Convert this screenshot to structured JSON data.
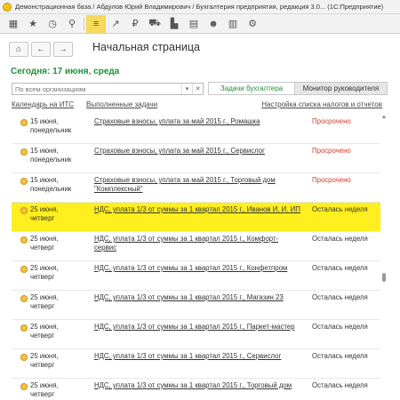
{
  "window": {
    "title": "Демонстрационная база / Абдулов Юрий Владимирович / Бухгалтерия предприятия, редакция 3.0... (1С:Предприятие)"
  },
  "toolbar": {
    "icons": [
      "grid-icon",
      "star-icon",
      "history-icon",
      "search-icon",
      "menu-icon",
      "chart-icon",
      "currency-icon",
      "cart-icon",
      "factory-icon",
      "warehouse-icon",
      "people-icon",
      "report-icon",
      "gear-icon"
    ]
  },
  "page": {
    "title": "Начальная страница",
    "today": "Сегодня: 17 июня, среда"
  },
  "filter": {
    "placeholder": "По всем организациям"
  },
  "tabs": {
    "accountant": "Задачи бухгалтера",
    "manager": "Монитор руководителя"
  },
  "links": {
    "calendar": "Календарь на ИТС",
    "done": "Выполненные задачи",
    "settings": "Настройка списка налогов и отчетов"
  },
  "tasks": [
    {
      "date": "15 июня, понедельник",
      "task": "Страховые взносы, уплата за май 2015 г., Ромашка",
      "status": "Просрочено",
      "overdue": true
    },
    {
      "date": "15 июня, понедельник",
      "task": "Страховые взносы, уплата за май 2015 г., Сервислог",
      "status": "Просрочено",
      "overdue": true
    },
    {
      "date": "15 июня, понедельник",
      "task": "Страховые взносы, уплата за май 2015 г., Торговый дом \"Комплексный\"",
      "status": "Просрочено",
      "overdue": true
    },
    {
      "date": "25 июня, четверг",
      "task": "НДС, уплата 1/3 от суммы за 1 квартал 2015 г., Иванов И. И. ИП",
      "status": "Осталась неделя",
      "overdue": false
    },
    {
      "date": "25 июня, четверг",
      "task": "НДС, уплата 1/3 от суммы за 1 квартал 2015 г., Комфорт-сервис",
      "status": "Осталась неделя",
      "overdue": false
    },
    {
      "date": "25 июня, четверг",
      "task": "НДС, уплата 1/3 от суммы за 1 квартал 2015 г., Конфетпром",
      "status": "Осталась неделя",
      "overdue": false
    },
    {
      "date": "25 июня, четверг",
      "task": "НДС, уплата 1/3 от суммы за 1 квартал 2015 г., Магазин 23",
      "status": "Осталась неделя",
      "overdue": false
    },
    {
      "date": "25 июня, четверг",
      "task": "НДС, уплата 1/3 от суммы за 1 квартал 2015 г., Паркет-мастер",
      "status": "Осталась неделя",
      "overdue": false
    },
    {
      "date": "25 июня, четверг",
      "task": "НДС, уплата 1/3 от суммы за 1 квартал 2015 г., Сервислог",
      "status": "Осталась неделя",
      "overdue": false
    },
    {
      "date": "25 июня, четверг",
      "task": "НДС, уплата 1/3 от суммы за 1 квартал 2015 г., Торговый дом",
      "status": "Осталась неделя",
      "overdue": false
    }
  ],
  "colors": {
    "accent_green": "#1f8f3a",
    "overdue_red": "#d23a2c",
    "highlight_yellow": "#ffef1e"
  }
}
